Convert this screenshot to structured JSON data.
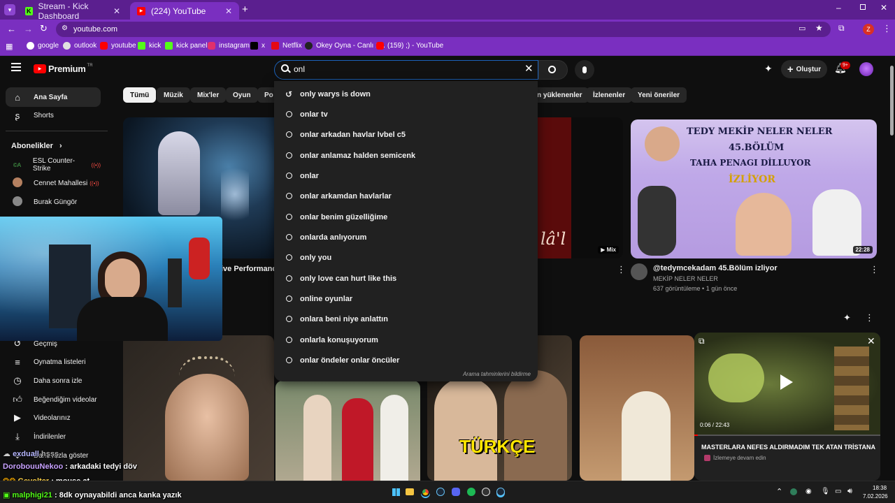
{
  "browser": {
    "tabs": [
      {
        "title": "Stream - Kick Dashboard",
        "icon": "kick-icon"
      },
      {
        "title": "(224) YouTube",
        "icon": "youtube-icon"
      }
    ],
    "new_tab": "+",
    "address": "youtube.com",
    "profile_initial": "Z",
    "bookmarks": [
      {
        "label": "google",
        "icon": "google-icon"
      },
      {
        "label": "outlook",
        "icon": "outlook-icon"
      },
      {
        "label": "youtube",
        "icon": "youtube-icon"
      },
      {
        "label": "kick",
        "icon": "kick-icon"
      },
      {
        "label": "kick panel",
        "icon": "kick-icon"
      },
      {
        "label": "instagram",
        "icon": "instagram-icon"
      },
      {
        "label": "x",
        "icon": "x-icon"
      },
      {
        "label": "Netflix",
        "icon": "netflix-icon"
      },
      {
        "label": "Okey Oyna - Canlı 1...",
        "icon": "okey-icon"
      },
      {
        "label": "(159) ;) - YouTube",
        "icon": "youtube-icon"
      }
    ]
  },
  "youtube": {
    "logo": "Premium",
    "logo_region": "TR",
    "search_query": "onl",
    "create_label": "Oluştur",
    "notif_badge": "9+",
    "chips": [
      "Tümü",
      "Müzik",
      "Mix'ler",
      "Oyun",
      "Po",
      "n yüklenenler",
      "İzlenenler",
      "Yeni öneriler"
    ],
    "sidebar_top": [
      {
        "label": "Ana Sayfa",
        "icon": "home-icon"
      },
      {
        "label": "Shorts",
        "icon": "shorts-icon"
      }
    ],
    "subs_heading": "Abonelikler",
    "subscriptions": [
      "ESL Counter-Strike",
      "Cennet Mahallesi",
      "Burak Güngör"
    ],
    "you_items": [
      {
        "label": "Geçmiş",
        "icon": "history-icon"
      },
      {
        "label": "Oynatma listeleri",
        "icon": "playlist-icon"
      },
      {
        "label": "Daha sonra izle",
        "icon": "clock-icon"
      },
      {
        "label": "Beğendiğim videolar",
        "icon": "like-icon"
      },
      {
        "label": "Videolarınız",
        "icon": "video-icon"
      },
      {
        "label": "İndirilenler",
        "icon": "download-icon"
      }
    ],
    "show_more": "Daha fazla göster",
    "suggestions": [
      {
        "text": "only warys is down",
        "icon": "history-icon"
      },
      {
        "text": "onlar tv",
        "icon": "search-icon"
      },
      {
        "text": "onlar arkadan havlar lvbel c5",
        "icon": "search-icon"
      },
      {
        "text": "onlar anlamaz halden semicenk",
        "icon": "search-icon"
      },
      {
        "text": "onlar",
        "icon": "search-icon"
      },
      {
        "text": "onlar arkamdan havlarlar",
        "icon": "search-icon"
      },
      {
        "text": "onlar benim güzelliğime",
        "icon": "search-icon"
      },
      {
        "text": "onlarda anlıyorum",
        "icon": "search-icon"
      },
      {
        "text": "only you",
        "icon": "search-icon"
      },
      {
        "text": "only love can hurt like this",
        "icon": "search-icon"
      },
      {
        "text": "online oyunlar",
        "icon": "search-icon"
      },
      {
        "text": "onlara beni niye anlattın",
        "icon": "search-icon"
      },
      {
        "text": "onlarla konuşuyorum",
        "icon": "search-icon"
      },
      {
        "text": "onlar öndeler onlar öncüler",
        "icon": "search-icon"
      }
    ],
    "report_predictions": "Arama tahminlerini bildirme",
    "video1_title_fragment": "ive Performance",
    "mix_badge": "Mix",
    "mix_thumb_text": "lâ'l",
    "video3": {
      "title": "@tedymcekadam 45.Bölüm izliyor",
      "channel": "MEKİP NELER NELER",
      "meta": "637 görüntüleme • 1 gün önce",
      "duration": "22:28",
      "thumb_line1": "TEDY MEKİP NELER NELER",
      "thumb_line2": "45.BÖLÜM",
      "thumb_line3": "TAHA PENAGI DİLLUYOR",
      "thumb_line4": "İZLİYOR"
    },
    "turkce_text": "TÜRKÇE",
    "miniplayer": {
      "time": "0:06 / 22:43",
      "title": "MASTERLARA NEFES ALDIRMADIM TEK ATAN TRİSTANA",
      "continue": "İzlemeye devam edin"
    }
  },
  "chat": [
    {
      "user": "exduall",
      "msg": "hşşş",
      "color": "#b7b7ff"
    },
    {
      "user": "DorobouuNekoo",
      "msg": ": arkadaki tedyi döv",
      "color": "#c8a2ff"
    },
    {
      "user": "Gevolter",
      "msg": ": mouse at",
      "color": "#ffd24a"
    },
    {
      "user": "malphigi21",
      "msg": ": 8dk oynayabildi anca kanka yazık",
      "color": "#53fc18"
    }
  ],
  "taskbar": {
    "time": "18:38",
    "date": "7.02.2026"
  }
}
